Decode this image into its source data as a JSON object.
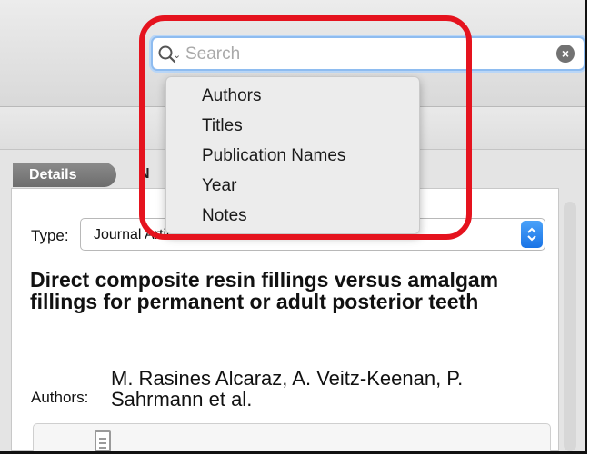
{
  "search": {
    "placeholder": "Search",
    "value": "",
    "menu": [
      "Authors",
      "Titles",
      "Publication Names",
      "Year",
      "Notes"
    ]
  },
  "tabs": {
    "details_label": "Details",
    "next_label_visible": "N"
  },
  "reference": {
    "type_label": "Type:",
    "type_value_visible": "Journal Article",
    "title": "Direct composite resin fillings versus amalgam fillings for permanent or adult posterior teeth",
    "authors_label": "Authors:",
    "authors": "M. Rasines Alcaraz, A. Veitz-Keenan, P. Sahrmann et al."
  },
  "icons": {
    "search": "magnifier-icon",
    "clear": "clear-x-icon",
    "select": "updown-chevron-icon",
    "attachment": "document-icon"
  },
  "colors": {
    "highlight": "#e5131e",
    "focus_ring": "#8ebcf0",
    "select_accent": "#1a74e6"
  }
}
